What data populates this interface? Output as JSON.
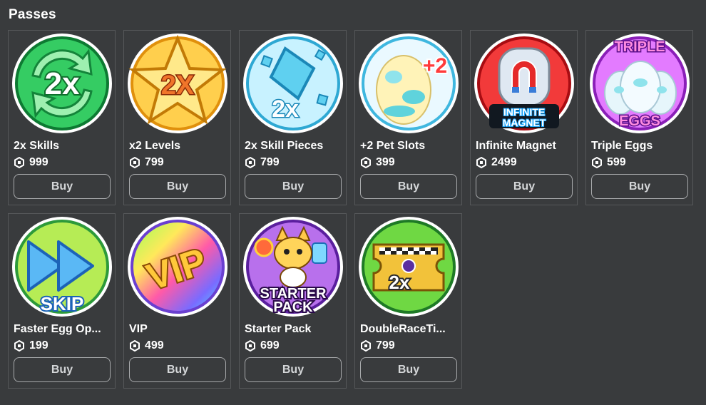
{
  "section": {
    "title": "Passes"
  },
  "passes": [
    {
      "name": "2x Skills",
      "price": "999",
      "buy_label": "Buy",
      "icon": "two-x-skills-icon",
      "icon_text": "2x",
      "colors": [
        "#3bd46a",
        "#14a044"
      ]
    },
    {
      "name": "x2 Levels",
      "price": "799",
      "buy_label": "Buy",
      "icon": "x2-levels-star-icon",
      "icon_text": "2X",
      "colors": [
        "#ffd659",
        "#e89a12"
      ]
    },
    {
      "name": "2x Skill Pieces",
      "price": "799",
      "buy_label": "Buy",
      "icon": "skill-pieces-icon",
      "icon_text": "2x",
      "colors": [
        "#bff1ff",
        "#4fc6e8"
      ]
    },
    {
      "name": "+2 Pet Slots",
      "price": "399",
      "buy_label": "Buy",
      "icon": "pet-slots-egg-icon",
      "icon_text": "+2",
      "colors": [
        "#e8f8ff",
        "#86d8f2"
      ]
    },
    {
      "name": "Infinite Magnet",
      "price": "2499",
      "buy_label": "Buy",
      "icon": "infinite-magnet-icon",
      "icon_text": "INFINITE MAGNET",
      "colors": [
        "#ff4a4a",
        "#b10f14"
      ]
    },
    {
      "name": "Triple Eggs",
      "price": "599",
      "buy_label": "Buy",
      "icon": "triple-eggs-icon",
      "icon_text": "TRIPLE EGGS",
      "colors": [
        "#e97bff",
        "#9b2cc7"
      ]
    },
    {
      "name": "Faster Egg Op...",
      "price": "199",
      "buy_label": "Buy",
      "icon": "skip-fast-forward-icon",
      "icon_text": "SKIP",
      "colors": [
        "#b9ee56",
        "#43b83c"
      ]
    },
    {
      "name": "VIP",
      "price": "499",
      "buy_label": "Buy",
      "icon": "vip-rainbow-icon",
      "icon_text": "VIP",
      "colors": [
        "#ff5fa8",
        "#5fd7ff"
      ]
    },
    {
      "name": "Starter Pack",
      "price": "699",
      "buy_label": "Buy",
      "icon": "starter-pack-icon",
      "icon_text": "STARTER PACK",
      "colors": [
        "#c07ff0",
        "#6b2fb3"
      ]
    },
    {
      "name": "DoubleRaceTi...",
      "price": "799",
      "buy_label": "Buy",
      "icon": "double-race-ticket-icon",
      "icon_text": "2x",
      "colors": [
        "#7be04a",
        "#2b9a2e"
      ]
    }
  ],
  "currency_icon": "robux-icon"
}
